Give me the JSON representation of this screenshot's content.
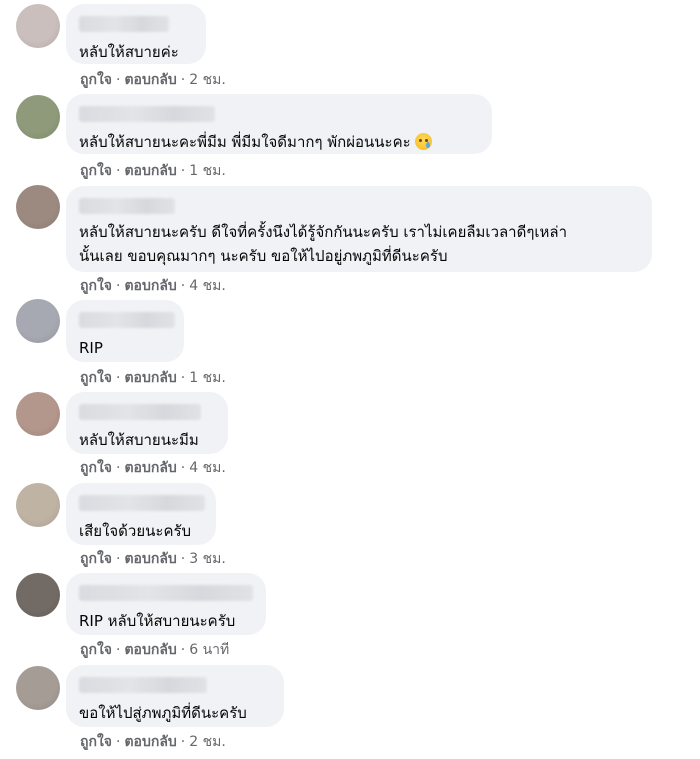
{
  "actions": {
    "like": "ถูกใจ",
    "reply": "ตอบกลับ"
  },
  "comments": [
    {
      "text": "หลับให้สบายค่ะ",
      "time": "2 ชม.",
      "avatar_color": "#cbbfbe"
    },
    {
      "text": "หลับให้สบายนะคะพี่มีม พี่มีมใจดีมากๆ พักผ่อนนะคะ",
      "time": "1 ชม.",
      "avatar_color": "#8f9a7a",
      "emoji": "crying-face-icon"
    },
    {
      "text": "หลับให้สบายนะครับ ดีใจที่ครั้งนึงได้รู้จักกันนะครับ เราไม่เคยลืมเวลาดีๆเหล่า\nนั้นเลย ขอบคุณมากๆ นะครับ ขอให้ไปอยู่ภพภูมิที่ดีนะครับ",
      "time": "4 ชม.",
      "avatar_color": "#9c8a80"
    },
    {
      "text": "RIP",
      "time": "1 ชม.",
      "avatar_color": "#a7a9b2"
    },
    {
      "text": "หลับให้สบายนะมีม",
      "time": "4 ชม.",
      "avatar_color": "#b3968c"
    },
    {
      "text": "เสียใจด้วยนะครับ",
      "time": "3 ชม.",
      "avatar_color": "#bfb3a4"
    },
    {
      "text": "RIP หลับให้สบายนะครับ",
      "time": "6 นาที",
      "avatar_color": "#726a64"
    },
    {
      "text": "ขอให้ไปสู่ภพภูมิที่ดีนะครับ",
      "time": "2 ชม.",
      "avatar_color": "#a59c96"
    }
  ]
}
